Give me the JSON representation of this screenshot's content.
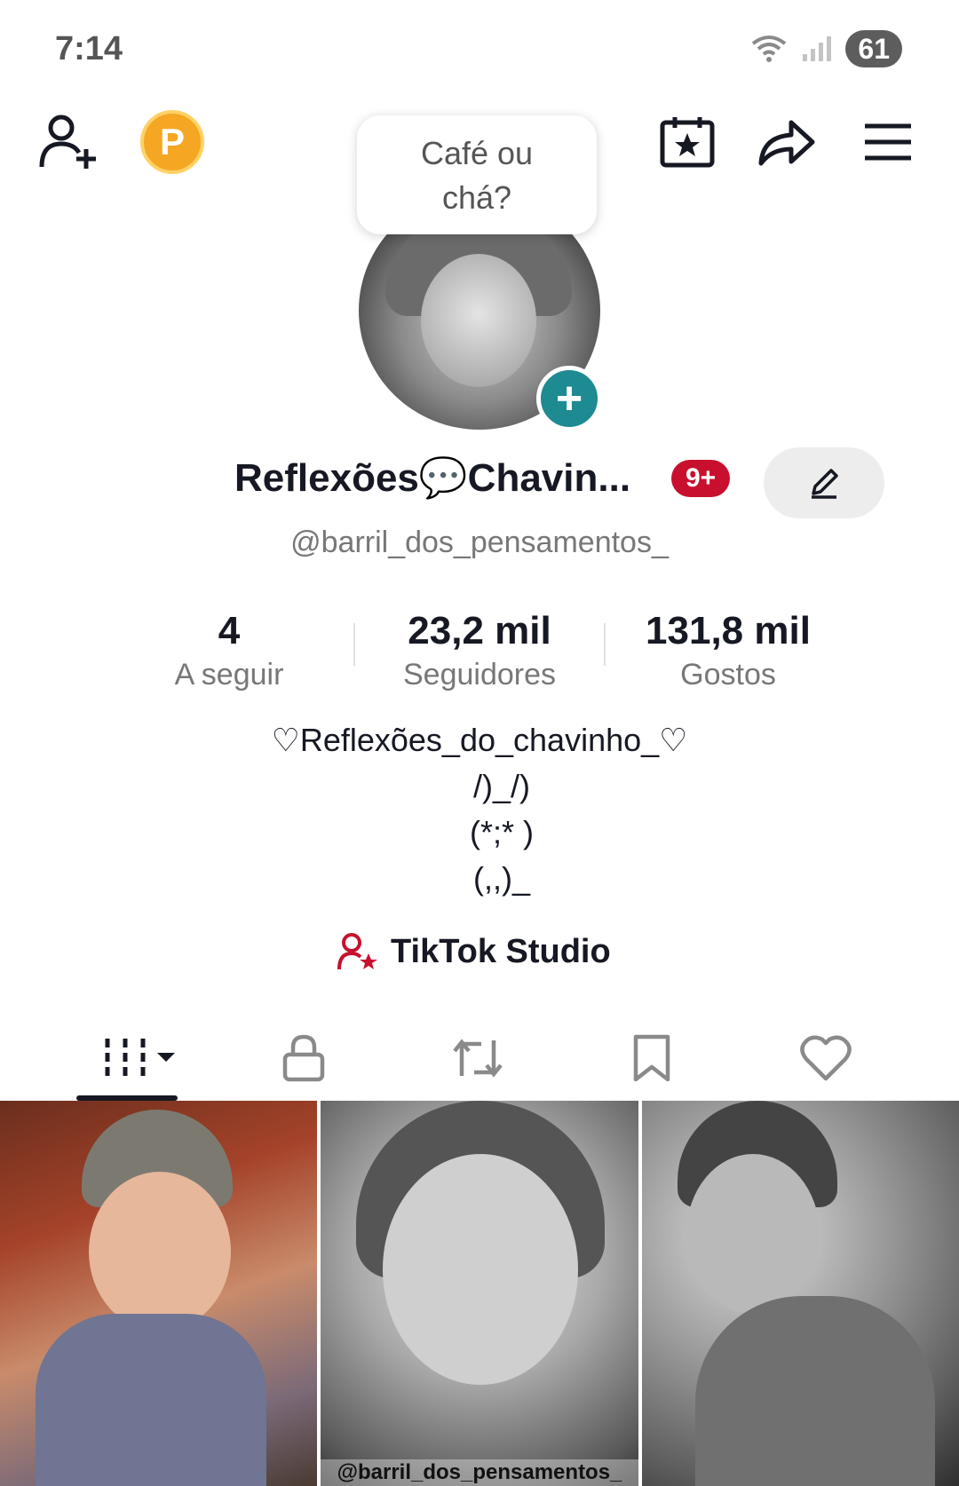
{
  "status_bar": {
    "time": "7:14",
    "battery": "61"
  },
  "top_nav": {
    "coin_label": "P"
  },
  "note": {
    "text": "Café ou\nchá?"
  },
  "profile": {
    "display_name": "Reflexões💬Chavin...",
    "notification_badge": "9+",
    "username": "@barril_dos_pensamentos_"
  },
  "stats": [
    {
      "value": "4",
      "label": "A seguir"
    },
    {
      "value": "23,2 mil",
      "label": "Seguidores"
    },
    {
      "value": "131,8 mil",
      "label": "Gostos"
    }
  ],
  "bio": "♡Reflexões_do_chavinho_♡\n     /)_/)\n     (*;* )\n     (,,)_",
  "studio": {
    "label": "TikTok Studio"
  },
  "videos": [
    {
      "caption": ""
    },
    {
      "caption": "@barril_dos_pensamentos_"
    },
    {
      "caption": ""
    }
  ],
  "colors": {
    "accent_red": "#c8102e",
    "teal": "#1e8a92",
    "coin": "#f5a623"
  }
}
